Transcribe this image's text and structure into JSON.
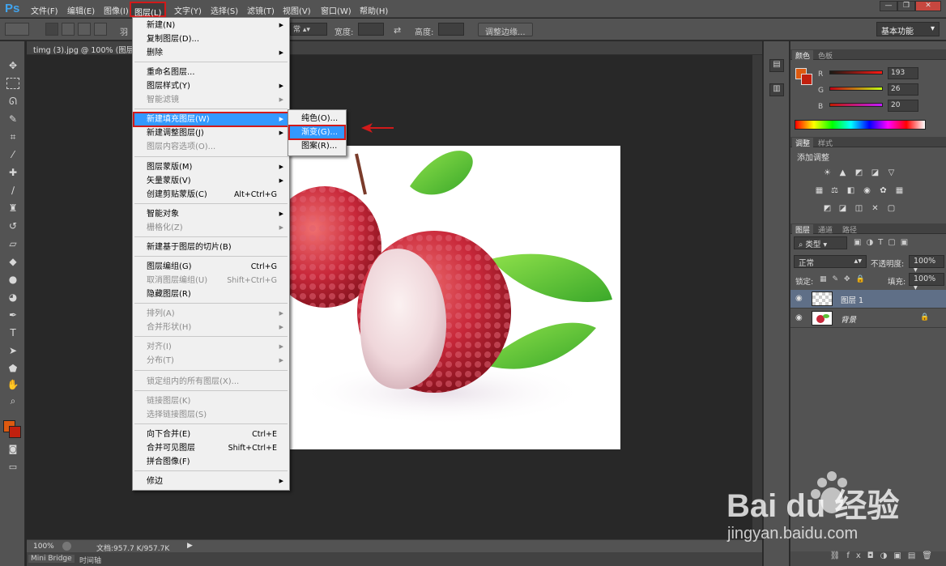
{
  "app": {
    "logo": "Ps",
    "colors": {
      "accent": "#3399ff",
      "highlight_box": "#d11a1a",
      "fg_color": "#c1200e",
      "bg_color": "#c1200e"
    }
  },
  "menubar": {
    "items": [
      "文件(F)",
      "编辑(E)",
      "图像(I)",
      "图层(L)",
      "文字(Y)",
      "选择(S)",
      "滤镜(T)",
      "视图(V)",
      "窗口(W)",
      "帮助(H)"
    ],
    "active_index": 3
  },
  "options_bar": {
    "feather_label": "羽",
    "style_value": "常",
    "width_label": "宽度:",
    "height_label": "高度:",
    "refine_edge_button": "调整边缘...",
    "workspace": "基本功能"
  },
  "document": {
    "tab_title": "timg (3).jpg @ 100% (图层 1",
    "zoom": "100%",
    "doc_size": "文档:957.7 K/957.7K"
  },
  "bottom_tabs": [
    "Mini Bridge",
    "时间轴"
  ],
  "layer_menu": {
    "items": [
      {
        "label": "新建(N)",
        "shortcut": "",
        "arrow": true,
        "disabled": false
      },
      {
        "label": "复制图层(D)...",
        "shortcut": "",
        "arrow": false,
        "disabled": false
      },
      {
        "label": "删除",
        "shortcut": "",
        "arrow": true,
        "disabled": false
      },
      {
        "label": "重命名图层...",
        "shortcut": "",
        "arrow": false,
        "disabled": false
      },
      {
        "label": "图层样式(Y)",
        "shortcut": "",
        "arrow": true,
        "disabled": false
      },
      {
        "label": "智能滤镜",
        "shortcut": "",
        "arrow": true,
        "disabled": true
      },
      {
        "label": "新建填充图层(W)",
        "shortcut": "",
        "arrow": true,
        "disabled": false,
        "highlighted": true
      },
      {
        "label": "新建调整图层(J)",
        "shortcut": "",
        "arrow": true,
        "disabled": false
      },
      {
        "label": "图层内容选项(O)...",
        "shortcut": "",
        "arrow": false,
        "disabled": true
      },
      {
        "label": "图层蒙版(M)",
        "shortcut": "",
        "arrow": true,
        "disabled": false
      },
      {
        "label": "矢量蒙版(V)",
        "shortcut": "",
        "arrow": true,
        "disabled": false
      },
      {
        "label": "创建剪贴蒙版(C)",
        "shortcut": "Alt+Ctrl+G",
        "arrow": false,
        "disabled": false
      },
      {
        "label": "智能对象",
        "shortcut": "",
        "arrow": true,
        "disabled": false
      },
      {
        "label": "栅格化(Z)",
        "shortcut": "",
        "arrow": true,
        "disabled": true
      },
      {
        "label": "新建基于图层的切片(B)",
        "shortcut": "",
        "arrow": false,
        "disabled": false
      },
      {
        "label": "图层编组(G)",
        "shortcut": "Ctrl+G",
        "arrow": false,
        "disabled": false
      },
      {
        "label": "取消图层编组(U)",
        "shortcut": "Shift+Ctrl+G",
        "arrow": false,
        "disabled": true
      },
      {
        "label": "隐藏图层(R)",
        "shortcut": "",
        "arrow": false,
        "disabled": false
      },
      {
        "label": "排列(A)",
        "shortcut": "",
        "arrow": true,
        "disabled": true
      },
      {
        "label": "合并形状(H)",
        "shortcut": "",
        "arrow": true,
        "disabled": true
      },
      {
        "label": "对齐(I)",
        "shortcut": "",
        "arrow": true,
        "disabled": true
      },
      {
        "label": "分布(T)",
        "shortcut": "",
        "arrow": true,
        "disabled": true
      },
      {
        "label": "锁定组内的所有图层(X)...",
        "shortcut": "",
        "arrow": false,
        "disabled": true
      },
      {
        "label": "链接图层(K)",
        "shortcut": "",
        "arrow": false,
        "disabled": true
      },
      {
        "label": "选择链接图层(S)",
        "shortcut": "",
        "arrow": false,
        "disabled": true
      },
      {
        "label": "向下合并(E)",
        "shortcut": "Ctrl+E",
        "arrow": false,
        "disabled": false
      },
      {
        "label": "合并可见图层",
        "shortcut": "Shift+Ctrl+E",
        "arrow": false,
        "disabled": false
      },
      {
        "label": "拼合图像(F)",
        "shortcut": "",
        "arrow": false,
        "disabled": false
      },
      {
        "label": "修边",
        "shortcut": "",
        "arrow": true,
        "disabled": false
      }
    ]
  },
  "fill_submenu": {
    "items": [
      {
        "label": "纯色(O)...",
        "highlighted": false
      },
      {
        "label": "渐变(G)...",
        "highlighted": true
      },
      {
        "label": "图案(R)...",
        "highlighted": false
      }
    ]
  },
  "color_panel": {
    "tabs": [
      "颜色",
      "色板"
    ],
    "channels": [
      {
        "label": "R",
        "value": "193"
      },
      {
        "label": "G",
        "value": "26"
      },
      {
        "label": "B",
        "value": "20"
      }
    ]
  },
  "adjust_panel": {
    "tabs": [
      "调整",
      "样式"
    ],
    "title": "添加调整"
  },
  "layers_panel": {
    "tabs": [
      "图层",
      "通道",
      "路径"
    ],
    "filter": "类型",
    "blend_mode": "正常",
    "opacity_label": "不透明度:",
    "opacity": "100%",
    "lock_label": "锁定:",
    "fill_label": "填充:",
    "fill": "100%",
    "layers": [
      {
        "name": "图层 1",
        "active": true
      },
      {
        "name": "背景",
        "active": false
      }
    ]
  },
  "watermark": {
    "brand": "Bai du 经验",
    "url": "jingyan.baidu.com"
  }
}
